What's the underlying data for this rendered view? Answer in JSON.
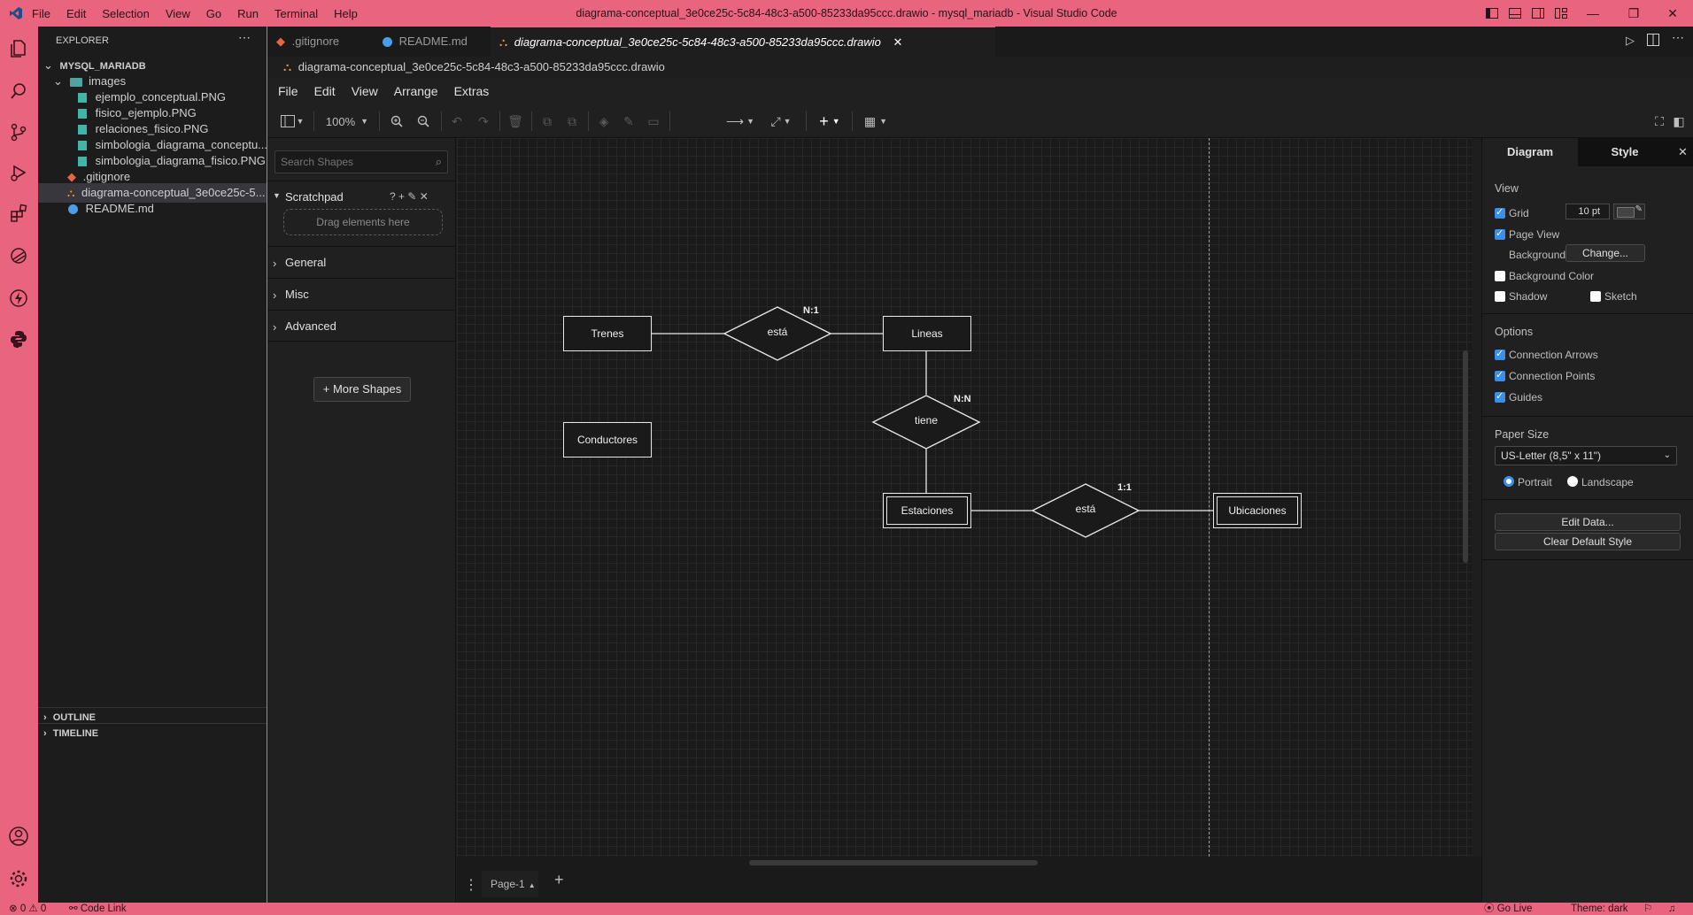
{
  "window": {
    "menu": [
      "File",
      "Edit",
      "Selection",
      "View",
      "Go",
      "Run",
      "Terminal",
      "Help"
    ],
    "title": "diagrama-conceptual_3e0ce25c-5c84-48c3-a500-85233da95ccc.drawio - mysql_mariadb - Visual Studio Code"
  },
  "explorer": {
    "header": "EXPLORER",
    "root": "MYSQL_MARIADB",
    "folder": "images",
    "files": [
      "ejemplo_conceptual.PNG",
      "fisico_ejemplo.PNG",
      "relaciones_fisico.PNG",
      "simbologia_diagrama_conceptu...",
      "simbologia_diagrama_fisico.PNG"
    ],
    "root_files": [
      ".gitignore",
      "diagrama-conceptual_3e0ce25c-5...",
      "README.md"
    ],
    "outline": "OUTLINE",
    "timeline": "TIMELINE"
  },
  "tabs": [
    ".gitignore",
    "README.md",
    "diagrama-conceptual_3e0ce25c-5c84-48c3-a500-85233da95ccc.drawio"
  ],
  "breadcrumb": "diagrama-conceptual_3e0ce25c-5c84-48c3-a500-85233da95ccc.drawio",
  "drawio": {
    "menu": [
      "File",
      "Edit",
      "View",
      "Arrange",
      "Extras"
    ],
    "zoom": "100%",
    "search_placeholder": "Search Shapes",
    "scratchpad": "Scratchpad",
    "scratch_icons": "? + ✎ ✕",
    "drag_hint": "Drag elements here",
    "categories": [
      "General",
      "Misc",
      "Advanced"
    ],
    "more_shapes": "More Shapes",
    "page_tab": "Page-1"
  },
  "diagram": {
    "entities": {
      "trenes": "Trenes",
      "lineas": "Lineas",
      "conductores": "Conductores",
      "estaciones": "Estaciones",
      "ubicaciones": "Ubicaciones"
    },
    "relations": {
      "esta1": "está",
      "tiene": "tiene",
      "esta2": "está"
    },
    "cardinalities": {
      "c1": "N:1",
      "c2": "N:N",
      "c3": "1:1"
    }
  },
  "format": {
    "tabs": [
      "Diagram",
      "Style"
    ],
    "view_head": "View",
    "grid": "Grid",
    "grid_size": "10 pt",
    "page_view": "Page View",
    "background": "Background",
    "change": "Change...",
    "background_color": "Background Color",
    "shadow": "Shadow",
    "sketch": "Sketch",
    "options_head": "Options",
    "connection_arrows": "Connection Arrows",
    "connection_points": "Connection Points",
    "guides": "Guides",
    "paper_head": "Paper Size",
    "paper_value": "US-Letter (8,5\" x 11\")",
    "portrait": "Portrait",
    "landscape": "Landscape",
    "edit_data": "Edit Data...",
    "clear_style": "Clear Default Style"
  },
  "status": {
    "problems": "⊗ 0 ⚠ 0",
    "code_link": "Code Link",
    "go_live": "Go Live",
    "theme": "Theme: dark"
  },
  "colors": {
    "accent": "#e9657f",
    "canvas": "#1a1a1a",
    "checkbox": "#3b8eea"
  }
}
